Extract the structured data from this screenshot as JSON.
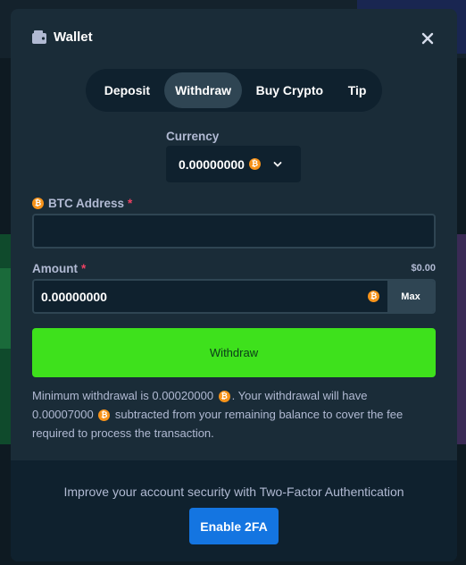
{
  "modal": {
    "title": "Wallet"
  },
  "tabs": [
    {
      "label": "Deposit",
      "active": false
    },
    {
      "label": "Withdraw",
      "active": true
    },
    {
      "label": "Buy Crypto",
      "active": false
    },
    {
      "label": "Tip",
      "active": false
    }
  ],
  "currency": {
    "label": "Currency",
    "value": "0.00000000",
    "coin": "BTC"
  },
  "address": {
    "label": "BTC Address",
    "required_mark": "*",
    "value": ""
  },
  "amount": {
    "label": "Amount",
    "required_mark": "*",
    "usd_value": "$0.00",
    "value": "0.00000000",
    "max_label": "Max"
  },
  "withdraw_button": "Withdraw",
  "info": {
    "part1": "Minimum withdrawal is 0.00020000",
    "part2": ". Your withdrawal will have 0.00007000",
    "part3": " subtracted from your remaining balance to cover the fee required to process the transaction."
  },
  "footer": {
    "text": "Improve your account security with Two-Factor Authentication",
    "button": "Enable 2FA"
  },
  "colors": {
    "modal_bg": "#1a2c38",
    "withdraw_green": "#3ee11c",
    "enable_blue": "#1475e1",
    "btc_orange": "#f7931a"
  },
  "icons": {
    "wallet": "wallet-icon",
    "close": "close-icon",
    "btc": "btc-icon",
    "chevron": "chevron-down-icon"
  }
}
